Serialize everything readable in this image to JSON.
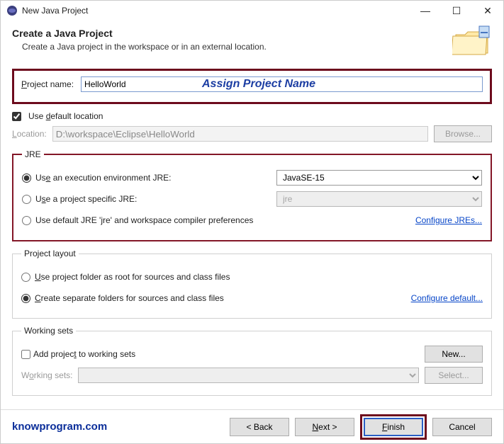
{
  "window_title": "New Java Project",
  "header": {
    "title": "Create a Java Project",
    "subtitle": "Create a Java project in the workspace or in an external location."
  },
  "project": {
    "name_label": "Project name:",
    "name_value": "HelloWorld",
    "annotation": "Assign Project Name",
    "use_default_label": "Use default location",
    "location_label": "Location:",
    "location_value": "D:\\workspace\\Eclipse\\HelloWorld",
    "browse": "Browse..."
  },
  "jre": {
    "legend": "JRE",
    "exec_env_label": "Use an execution environment JRE:",
    "exec_env_value": "JavaSE-15",
    "project_specific_label": "Use a project specific JRE:",
    "project_specific_value": "jre",
    "default_label": "Use default JRE 'jre' and workspace compiler preferences",
    "configure": "Configure JREs..."
  },
  "layout": {
    "legend": "Project layout",
    "root_label": "Use project folder as root for sources and class files",
    "separate_label": "Create separate folders for sources and class files",
    "configure": "Configure default..."
  },
  "workingsets": {
    "legend": "Working sets",
    "add_label": "Add project to working sets",
    "new": "New...",
    "ws_label": "Working sets:",
    "select": "Select..."
  },
  "brand": "knowprogram.com",
  "buttons": {
    "back": "< Back",
    "next": "Next >",
    "finish": "Finish",
    "cancel": "Cancel"
  }
}
